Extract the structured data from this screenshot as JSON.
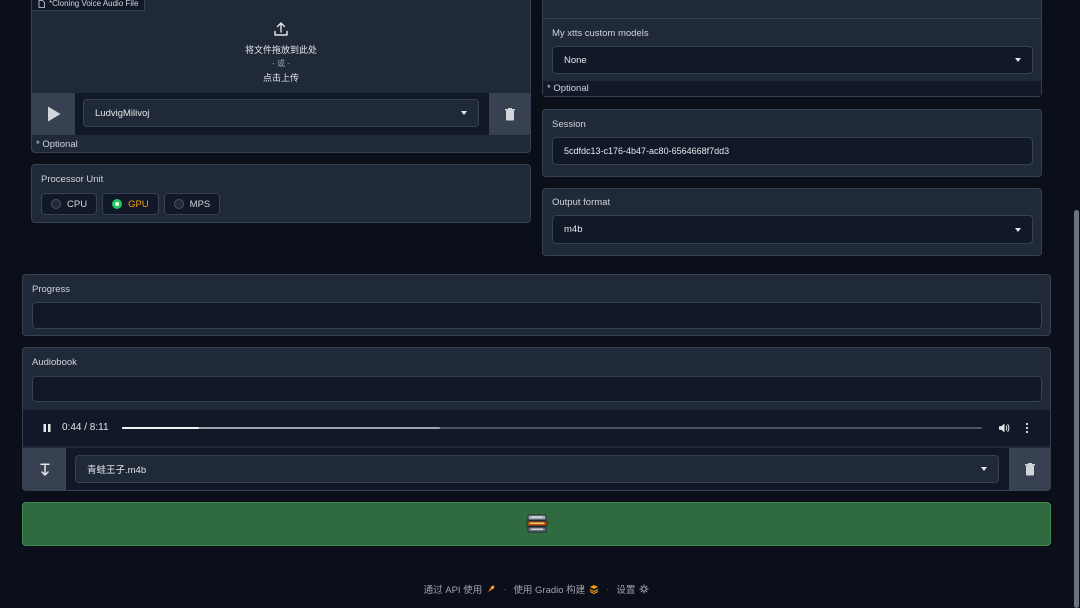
{
  "upload": {
    "tab_label": "*Cloning Voice Audio File",
    "drop_text": "将文件拖放到此处",
    "or_text": "- 或 -",
    "click_text": "点击上传",
    "voice_value": "LudvigMilivoj",
    "optional": "* Optional"
  },
  "processor": {
    "label": "Processor Unit",
    "options": [
      "CPU",
      "GPU",
      "MPS"
    ],
    "selected": "GPU"
  },
  "custom_models": {
    "label": "My xtts custom models",
    "value": "None",
    "optional": "* Optional"
  },
  "session": {
    "label": "Session",
    "value": "5cdfdc13-c176-4b47-ac80-6564668f7dd3"
  },
  "output_format": {
    "label": "Output format",
    "value": "m4b"
  },
  "progress": {
    "label": "Progress",
    "value": ""
  },
  "audiobook": {
    "label": "Audiobook",
    "value": "",
    "player": {
      "time": "0:44 / 8:11",
      "played_fraction": 0.09,
      "buffered_fraction": 0.37
    },
    "file_value": "青蛙王子.m4b"
  },
  "convert_button": {
    "icon": "books-icon"
  },
  "footer": {
    "api": "通过 API 使用",
    "built": "使用 Gradio 构建",
    "settings": "设置"
  },
  "colors": {
    "background": "#0b0f19",
    "panel": "#1f2937",
    "accent_green": "#22c55e",
    "button_green": "#2f6b3f"
  }
}
